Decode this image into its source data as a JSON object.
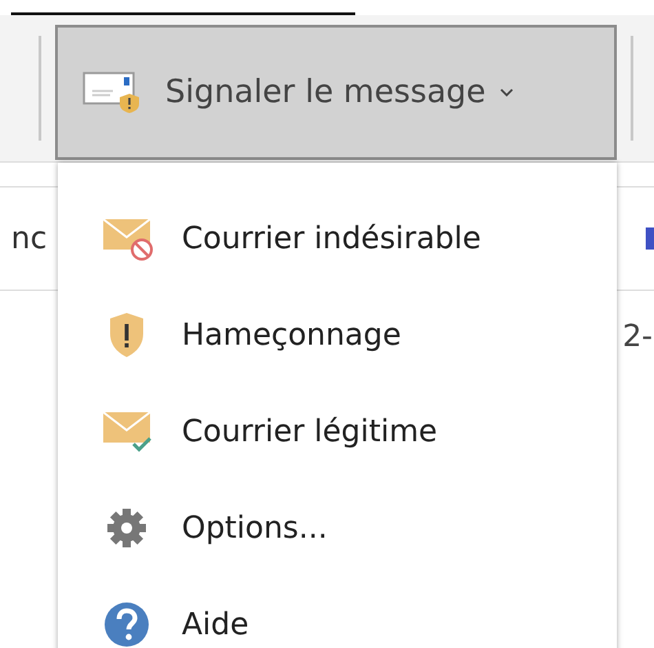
{
  "button": {
    "label": "Signaler le message",
    "expanded": true
  },
  "background": {
    "left_fragment": "nc",
    "right_fragment": "2-"
  },
  "menu": [
    {
      "kind": "junk",
      "label": "Courrier indésirable"
    },
    {
      "kind": "phishing",
      "label": "Hameçonnage"
    },
    {
      "kind": "safe",
      "label": "Courrier légitime"
    },
    {
      "kind": "settings",
      "label": "Options..."
    },
    {
      "kind": "help",
      "label": "Aide"
    }
  ]
}
